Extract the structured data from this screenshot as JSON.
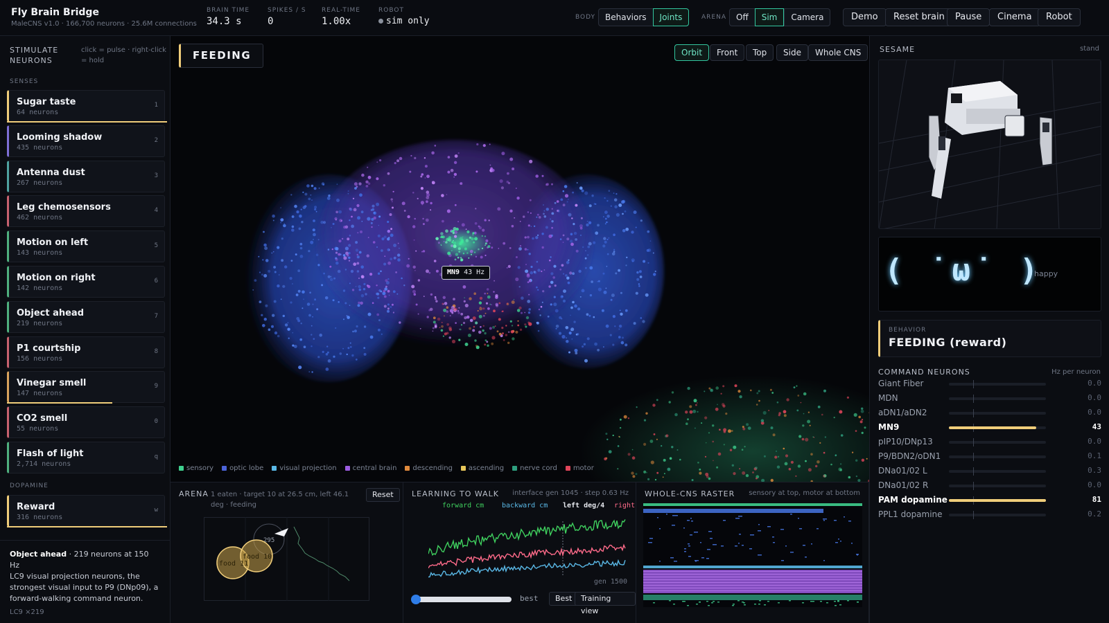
{
  "app": {
    "title": "Fly Brain Bridge",
    "subtitle": "MaleCNS v1.0 · 166,700 neurons · 25.6M connections"
  },
  "stats": [
    {
      "label": "BRAIN TIME",
      "value": "34.3 s"
    },
    {
      "label": "SPIKES / S",
      "value": "0"
    },
    {
      "label": "REAL-TIME",
      "value": "1.00x"
    },
    {
      "label": "ROBOT",
      "value": "sim only"
    }
  ],
  "body_group": {
    "label": "BODY",
    "options": [
      "Behaviors",
      "Joints"
    ],
    "selected": "Joints"
  },
  "arena_group": {
    "label": "ARENA",
    "options": [
      "Off",
      "Sim",
      "Camera"
    ],
    "selected": "Sim"
  },
  "top_buttons": [
    "Demo",
    "Reset brain",
    "Pause",
    "Cinema",
    "Robot"
  ],
  "left": {
    "title": "STIMULATE NEURONS",
    "hint": "click = pulse · right-click = hold",
    "senses_label": "SENSES",
    "dopamine_label": "DOPAMINE",
    "senses": [
      {
        "name": "Sugar taste",
        "count": "64",
        "key": "1",
        "color": "#f0cd7a",
        "active": 1.0
      },
      {
        "name": "Looming shadow",
        "count": "435",
        "key": "2",
        "color": "#7f6fd6",
        "active": 0
      },
      {
        "name": "Antenna dust",
        "count": "267",
        "key": "3",
        "color": "#4fa3a0",
        "active": 0
      },
      {
        "name": "Leg chemosensors",
        "count": "462",
        "key": "4",
        "color": "#c8626f",
        "active": 0
      },
      {
        "name": "Motion on left",
        "count": "143",
        "key": "5",
        "color": "#4fb07e",
        "active": 0
      },
      {
        "name": "Motion on right",
        "count": "142",
        "key": "6",
        "color": "#4fb07e",
        "active": 0
      },
      {
        "name": "Object ahead",
        "count": "219",
        "key": "7",
        "color": "#4fb07e",
        "active": 0
      },
      {
        "name": "P1 courtship",
        "count": "156",
        "key": "8",
        "color": "#c8626f",
        "active": 0
      },
      {
        "name": "Vinegar smell",
        "count": "147",
        "key": "9",
        "color": "#d9a35c",
        "active": 0.66
      },
      {
        "name": "CO2 smell",
        "count": "55",
        "key": "0",
        "color": "#c8626f",
        "active": 0
      },
      {
        "name": "Flash of light",
        "count": "2,714",
        "key": "q",
        "color": "#4fb07e",
        "active": 0
      }
    ],
    "dopamine": [
      {
        "name": "Reward",
        "count": "316",
        "key": "w",
        "color": "#f0cd7a",
        "active": 1.0
      }
    ],
    "neurons_word": "neurons",
    "info": {
      "name": "Object ahead",
      "summary": " · 219 neurons at 150 Hz",
      "desc": "LC9 visual projection neurons, the strongest visual input to P9 (DNp09), a forward-walking command neuron.",
      "foot": "LC9 ×219"
    }
  },
  "viewport": {
    "behavior": "FEEDING",
    "views": [
      "Orbit",
      "Front",
      "Top",
      "Side",
      "Whole CNS"
    ],
    "selected_view": "Orbit",
    "tag": {
      "name": "MN9",
      "rate": "43 Hz"
    },
    "legend": [
      {
        "label": "sensory",
        "color": "#3fcf8e"
      },
      {
        "label": "optic lobe",
        "color": "#4b63d8"
      },
      {
        "label": "visual projection",
        "color": "#5ab8e6"
      },
      {
        "label": "central brain",
        "color": "#9b5ce0"
      },
      {
        "label": "descending",
        "color": "#e08a3c"
      },
      {
        "label": "ascending",
        "color": "#e6c65a"
      },
      {
        "label": "nerve cord",
        "color": "#2e9e7e"
      },
      {
        "label": "motor",
        "color": "#e0455a"
      }
    ]
  },
  "arena": {
    "title": "ARENA",
    "meta": "1 eaten · target 10 at 26.5 cm, left 46.1 deg · feeding",
    "reset": "Reset",
    "foods": [
      "food 10",
      "food 11"
    ],
    "marker": "295"
  },
  "learning": {
    "title": "LEARNING TO WALK",
    "meta": "interface gen 1045 · step 0.63 Hz",
    "series_labels": [
      "forward cm",
      "backward cm",
      "left deg/4",
      "right"
    ],
    "gen_label": "gen 1500",
    "slider_value": 0,
    "best_label": "best",
    "best_btn": "Best",
    "training_btn": "Training view"
  },
  "raster": {
    "title": "WHOLE-CNS RASTER",
    "meta": "sensory at top, motor at bottom"
  },
  "right": {
    "title": "SESAME",
    "mode": "stand",
    "face": "( ˙ω˙ )",
    "mood": "happy",
    "behavior_label": "BEHAVIOR",
    "behavior_value": "FEEDING (reward)",
    "cmd_title": "COMMAND NEURONS",
    "cmd_unit": "Hz per neuron",
    "commands": [
      {
        "name": "Giant Fiber",
        "value": "0.0",
        "level": 0
      },
      {
        "name": "MDN",
        "value": "0.0",
        "level": 0
      },
      {
        "name": "aDN1/aDN2",
        "value": "0.0",
        "level": 0
      },
      {
        "name": "MN9",
        "value": "43",
        "level": 0.9,
        "hi": true
      },
      {
        "name": "pIP10/DNp13",
        "value": "0.0",
        "level": 0
      },
      {
        "name": "P9/BDN2/oDN1",
        "value": "0.1",
        "level": 0
      },
      {
        "name": "DNa01/02 L",
        "value": "0.3",
        "level": 0
      },
      {
        "name": "DNa01/02 R",
        "value": "0.0",
        "level": 0
      },
      {
        "name": "PAM dopamine",
        "value": "81",
        "level": 1.0,
        "hi": true
      },
      {
        "name": "PPL1 dopamine",
        "value": "0.2",
        "level": 0
      }
    ]
  }
}
